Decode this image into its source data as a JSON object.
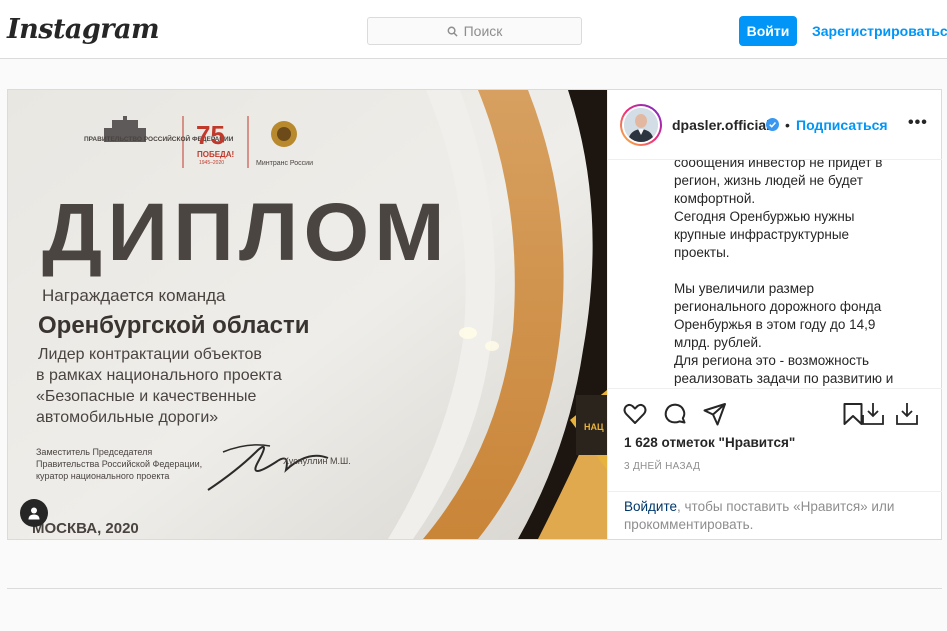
{
  "header": {
    "logo": "Instagram",
    "search_placeholder": "Поиск",
    "login_label": "Войти",
    "signup_label": "Зарегистрироваться"
  },
  "photo": {
    "diploma_org_left": "ПРАВИТЕЛЬСТВО РОССИЙСКОЙ ФЕДЕРАЦИИ",
    "diploma_logo_number": "75",
    "diploma_logo_word": "ПОБЕДА!",
    "diploma_logo_years": "1945–2020",
    "diploma_org_right": "Минтранс России",
    "title": "ДИПЛОМ",
    "awarded": "Награждается команда",
    "region": "Оренбургской области",
    "line1": "Лидер контрактации объектов",
    "line2": "в рамках национального проекта",
    "line3": "«Безопасные и качественные",
    "line4": "автомобильные дороги»",
    "sign1": "Заместитель Председателя",
    "sign2": "Правительства Российской Федерации,",
    "sign3": "куратор национального проекта",
    "signer": "Хуснуллин М.Ш.",
    "city": "МОСКВА, 2020",
    "right_edge_text": "НАЦ"
  },
  "post": {
    "username": "dpasler.official",
    "separator": "•",
    "follow_label": "Подписаться",
    "more_label": "•••",
    "caption_lines": [
      "сообщения инвестор не придет в",
      "регион,  жизнь людей не будет",
      "комфортной.",
      "Сегодня Оренбуржью нужны",
      "крупные инфраструктурные",
      "проекты.",
      "",
      "Мы увеличили размер",
      "регионального дорожного фонда",
      "Оренбуржья в этом году до 14,9",
      "млрд. рублей.",
      "Для региона это - возможность",
      "реализовать задачи по развитию и"
    ],
    "likes": "1 628 отметок \"Нравится\"",
    "time": "3 ДНЕЙ НАЗАД",
    "login_link": "Войдите",
    "login_rest": ", чтобы поставить «Нравится» или прокомментировать."
  },
  "colors": {
    "accent": "#0095f6",
    "border": "#dbdbdb",
    "text": "#262626",
    "muted": "#8e8e8e"
  },
  "icons": [
    "search-icon",
    "verified-badge-icon",
    "heart-icon",
    "comment-icon",
    "share-icon",
    "bookmark-icon",
    "download-icon",
    "user-tag-icon"
  ]
}
